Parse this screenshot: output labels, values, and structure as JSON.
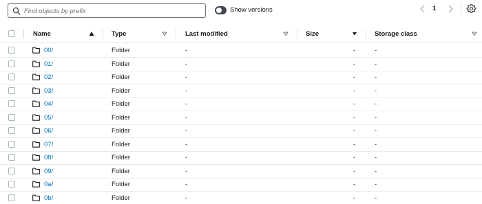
{
  "toolbar": {
    "search_placeholder": "Find objects by prefix",
    "show_versions_label": "Show versions",
    "show_versions_on": false,
    "current_page": "1"
  },
  "table": {
    "columns": {
      "name": "Name",
      "type": "Type",
      "last_modified": "Last modified",
      "size": "Size",
      "storage_class": "Storage class"
    },
    "rows": [
      {
        "name": "00/",
        "type": "Folder",
        "last_modified": "-",
        "size": "-",
        "storage_class": "-"
      },
      {
        "name": "01/",
        "type": "Folder",
        "last_modified": "-",
        "size": "-",
        "storage_class": "-"
      },
      {
        "name": "02/",
        "type": "Folder",
        "last_modified": "-",
        "size": "-",
        "storage_class": "-"
      },
      {
        "name": "03/",
        "type": "Folder",
        "last_modified": "-",
        "size": "-",
        "storage_class": "-"
      },
      {
        "name": "04/",
        "type": "Folder",
        "last_modified": "-",
        "size": "-",
        "storage_class": "-"
      },
      {
        "name": "05/",
        "type": "Folder",
        "last_modified": "-",
        "size": "-",
        "storage_class": "-"
      },
      {
        "name": "06/",
        "type": "Folder",
        "last_modified": "-",
        "size": "-",
        "storage_class": "-"
      },
      {
        "name": "07/",
        "type": "Folder",
        "last_modified": "-",
        "size": "-",
        "storage_class": "-"
      },
      {
        "name": "08/",
        "type": "Folder",
        "last_modified": "-",
        "size": "-",
        "storage_class": "-"
      },
      {
        "name": "09/",
        "type": "Folder",
        "last_modified": "-",
        "size": "-",
        "storage_class": "-"
      },
      {
        "name": "0a/",
        "type": "Folder",
        "last_modified": "-",
        "size": "-",
        "storage_class": "-"
      },
      {
        "name": "0b/",
        "type": "Folder",
        "last_modified": "-",
        "size": "-",
        "storage_class": "-"
      }
    ]
  },
  "colors": {
    "link": "#0073bb",
    "text": "#16191f",
    "border": "#eaeded",
    "muted": "#687078"
  }
}
